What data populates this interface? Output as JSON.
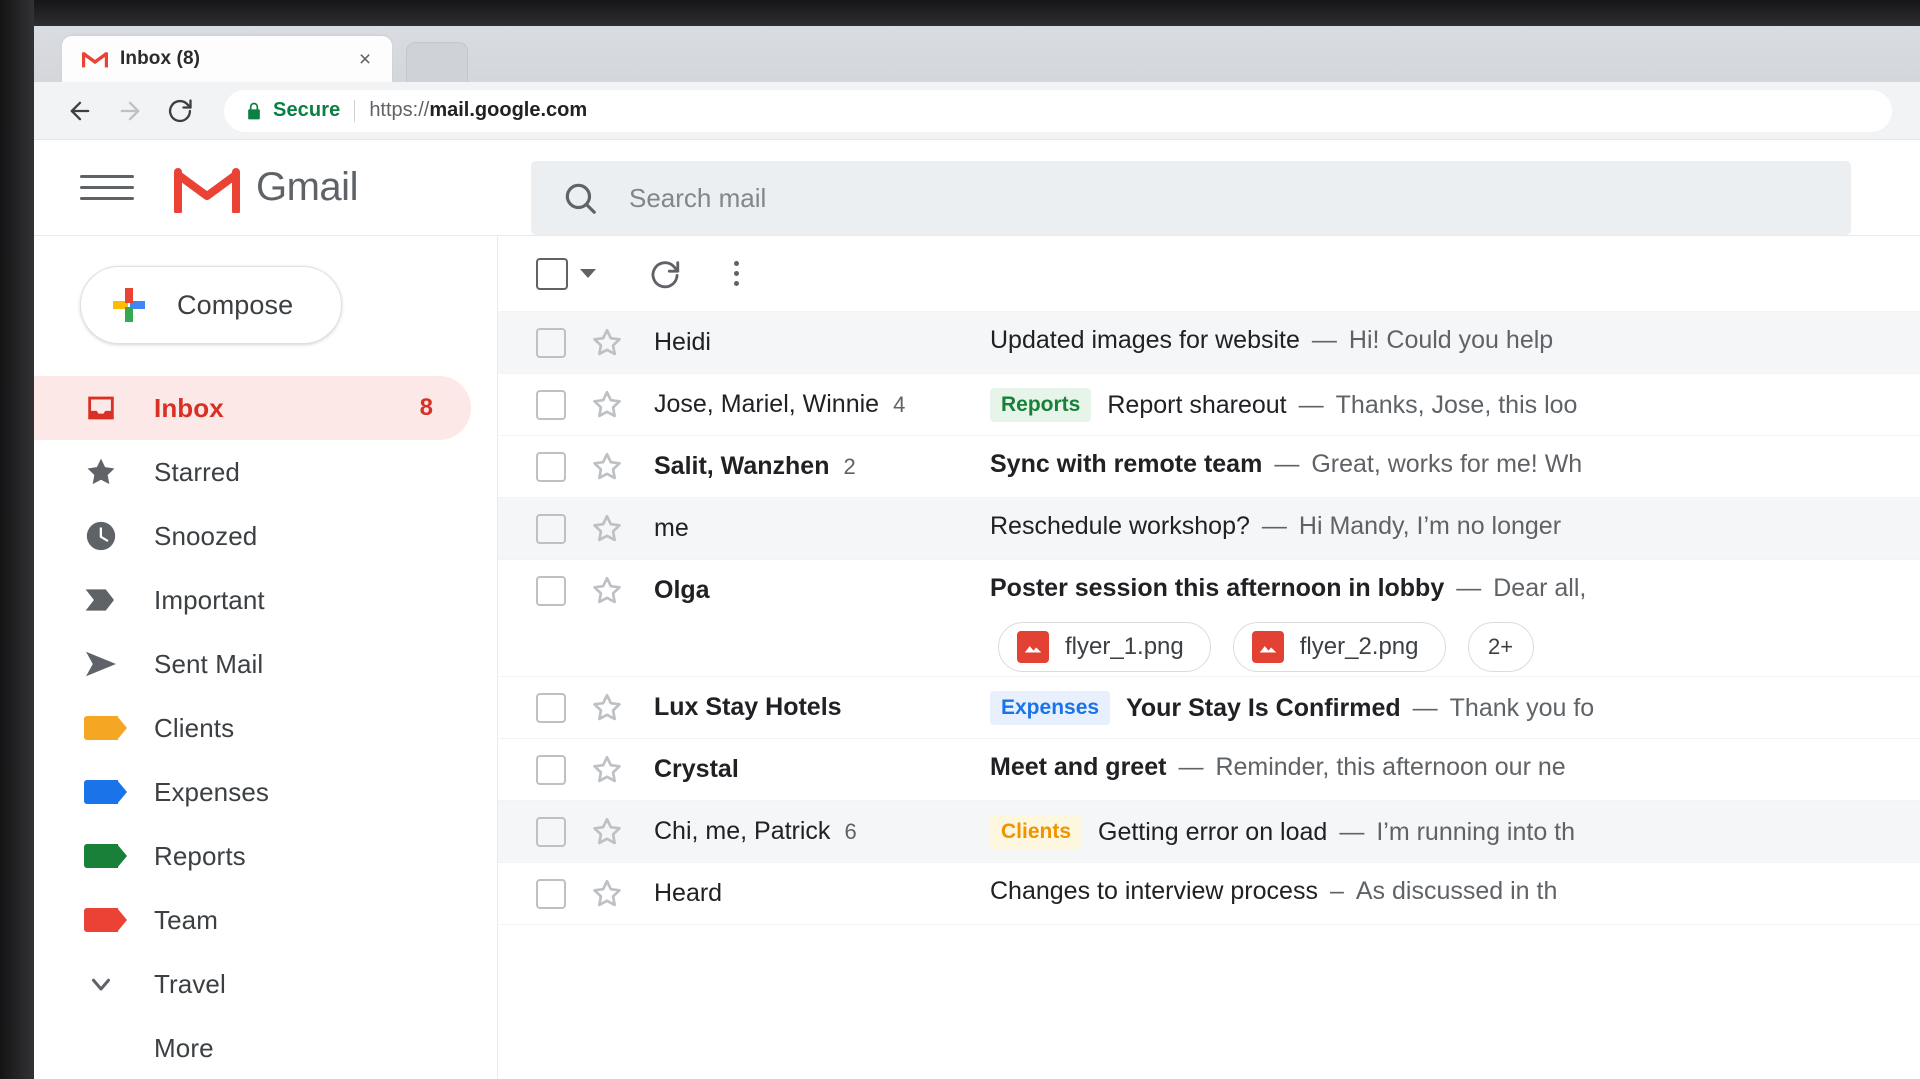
{
  "browser": {
    "tab_title": "Inbox (8)",
    "tab_favicon": "gmail-m-icon",
    "close_label": "×",
    "back_icon": "back-arrow-icon",
    "forward_icon": "forward-arrow-icon",
    "reload_icon": "reload-icon",
    "secure_label": "Secure",
    "url_scheme": "https://",
    "url_domain": "mail.google.com"
  },
  "header": {
    "menu_icon": "hamburger-icon",
    "logo_icon": "gmail-m-icon",
    "wordmark": "Gmail",
    "search_icon": "search-icon",
    "search_placeholder": "Search mail"
  },
  "sidebar": {
    "compose_label": "Compose",
    "compose_icon": "plus-icon",
    "items": [
      {
        "label": "Inbox",
        "icon": "inbox-icon",
        "count": "8",
        "active": true,
        "color": "#d93025"
      },
      {
        "label": "Starred",
        "icon": "star-icon",
        "count": "",
        "active": false,
        "color": "#5f6368"
      },
      {
        "label": "Snoozed",
        "icon": "clock-icon",
        "count": "",
        "active": false,
        "color": "#5f6368"
      },
      {
        "label": "Important",
        "icon": "important-icon",
        "count": "",
        "active": false,
        "color": "#5f6368"
      },
      {
        "label": "Sent Mail",
        "icon": "send-icon",
        "count": "",
        "active": false,
        "color": "#5f6368"
      },
      {
        "label": "Clients",
        "icon": "label-icon",
        "count": "",
        "active": false,
        "color": "#f5a623"
      },
      {
        "label": "Expenses",
        "icon": "label-icon",
        "count": "",
        "active": false,
        "color": "#1a73e8"
      },
      {
        "label": "Reports",
        "icon": "label-icon",
        "count": "",
        "active": false,
        "color": "#188038"
      },
      {
        "label": "Team",
        "icon": "label-icon",
        "count": "",
        "active": false,
        "color": "#ea4335"
      },
      {
        "label": "Travel",
        "icon": "chevron-down-icon",
        "count": "",
        "active": false,
        "color": "#5f6368"
      },
      {
        "label": "More",
        "icon": "none",
        "count": "",
        "active": false,
        "color": "#5f6368"
      }
    ]
  },
  "toolbar": {
    "select_all_icon": "checkbox-icon",
    "select_caret_icon": "chevron-down-icon",
    "refresh_icon": "refresh-icon",
    "more_icon": "more-vertical-icon"
  },
  "mail": {
    "rows": [
      {
        "sender": "Heidi",
        "count": "",
        "unread": false,
        "read_state": true,
        "label": "",
        "label_color": "",
        "label_bg": "",
        "subject": "Updated images for website",
        "dash": "—",
        "snippet": "Hi! Could you help",
        "attachments": []
      },
      {
        "sender": "Jose, Mariel, Winnie",
        "count": "4",
        "unread": false,
        "read_state": false,
        "label": "Reports",
        "label_color": "#188038",
        "label_bg": "#e6f4ea",
        "subject": "Report shareout",
        "dash": "—",
        "snippet": "Thanks, Jose, this loo",
        "attachments": []
      },
      {
        "sender": "Salit, Wanzhen",
        "count": "2",
        "unread": true,
        "read_state": false,
        "label": "",
        "label_color": "",
        "label_bg": "",
        "subject": "Sync with remote team",
        "dash": "—",
        "snippet": "Great, works for me! Wh",
        "attachments": []
      },
      {
        "sender": "me",
        "count": "",
        "unread": false,
        "read_state": true,
        "label": "",
        "label_color": "",
        "label_bg": "",
        "subject": "Reschedule workshop?",
        "dash": "—",
        "snippet": "Hi Mandy, I’m no longer",
        "attachments": []
      },
      {
        "sender": "Olga",
        "count": "",
        "unread": true,
        "read_state": false,
        "label": "",
        "label_color": "",
        "label_bg": "",
        "subject": "Poster session this afternoon in lobby",
        "dash": "—",
        "snippet": "Dear all,",
        "attachments": [
          "flyer_1.png",
          "flyer_2.png"
        ],
        "attachments_more": "2+"
      },
      {
        "sender": "Lux Stay Hotels",
        "count": "",
        "unread": true,
        "read_state": false,
        "label": "Expenses",
        "label_color": "#1a73e8",
        "label_bg": "#e8f0fe",
        "subject": "Your Stay Is Confirmed",
        "dash": "—",
        "snippet": "Thank you fo",
        "attachments": []
      },
      {
        "sender": "Crystal",
        "count": "",
        "unread": true,
        "read_state": false,
        "label": "",
        "label_color": "",
        "label_bg": "",
        "subject": "Meet and greet",
        "dash": "—",
        "snippet": "Reminder, this afternoon our ne",
        "attachments": []
      },
      {
        "sender": "Chi, me, Patrick",
        "count": "6",
        "unread": false,
        "read_state": true,
        "label": "Clients",
        "label_color": "#f09300",
        "label_bg": "#fef7e0",
        "subject": "Getting error on load",
        "dash": "—",
        "snippet": "I’m running into th",
        "attachments": []
      },
      {
        "sender": "Heard",
        "count": "",
        "unread": false,
        "read_state": false,
        "label": "",
        "label_color": "",
        "label_bg": "",
        "subject": "Changes to interview process",
        "dash": "–",
        "snippet": "As discussed in th",
        "attachments": []
      }
    ]
  }
}
